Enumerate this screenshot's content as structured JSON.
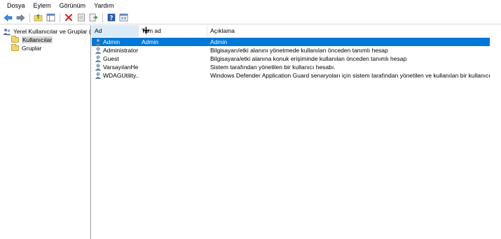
{
  "menu": [
    "Dosya",
    "Eylem",
    "Görünüm",
    "Yardım"
  ],
  "toolbar": {
    "buttons": [
      "back-arrow-icon",
      "forward-arrow-icon",
      "up-folder-icon",
      "show-hide-tree-icon",
      "delete-icon",
      "properties-icon",
      "export-list-icon",
      "help-icon",
      "console-tree-icon"
    ]
  },
  "tree": {
    "root_label": "Yerel Kullanıcılar ve Gruplar (Yerel)",
    "items": [
      {
        "label": "Kullanıcılar",
        "selected": true
      },
      {
        "label": "Gruplar",
        "selected": false
      }
    ]
  },
  "list": {
    "columns": [
      "Ad",
      "Tam ad",
      "Açıklama"
    ],
    "rows": [
      {
        "name": "Admin",
        "fullname": "Admin",
        "description": "Admin",
        "selected": true
      },
      {
        "name": "Administrator",
        "fullname": "",
        "description": "Bilgisayarı/etki alanını yönetmede kullanılan önceden tanımlı hesap",
        "selected": false
      },
      {
        "name": "Guest",
        "fullname": "",
        "description": "Bilgisayara/etki alanına konuk erişiminde kullanılan önceden tanımlı hesap",
        "selected": false
      },
      {
        "name": "VarsayılanHe...",
        "fullname": "",
        "description": "Sistem tarafından yönetilen bir kullanıcı hesabı.",
        "selected": false
      },
      {
        "name": "WDAGUtility...",
        "fullname": "",
        "description": "Windows Defender Application Guard senaryoları için sistem tarafından yönetilen ve kullanılan bir kullanıcı hesabı.",
        "selected": false
      }
    ]
  },
  "colors": {
    "selection": "#0078d7",
    "header_hover": "#d9ebf9"
  }
}
